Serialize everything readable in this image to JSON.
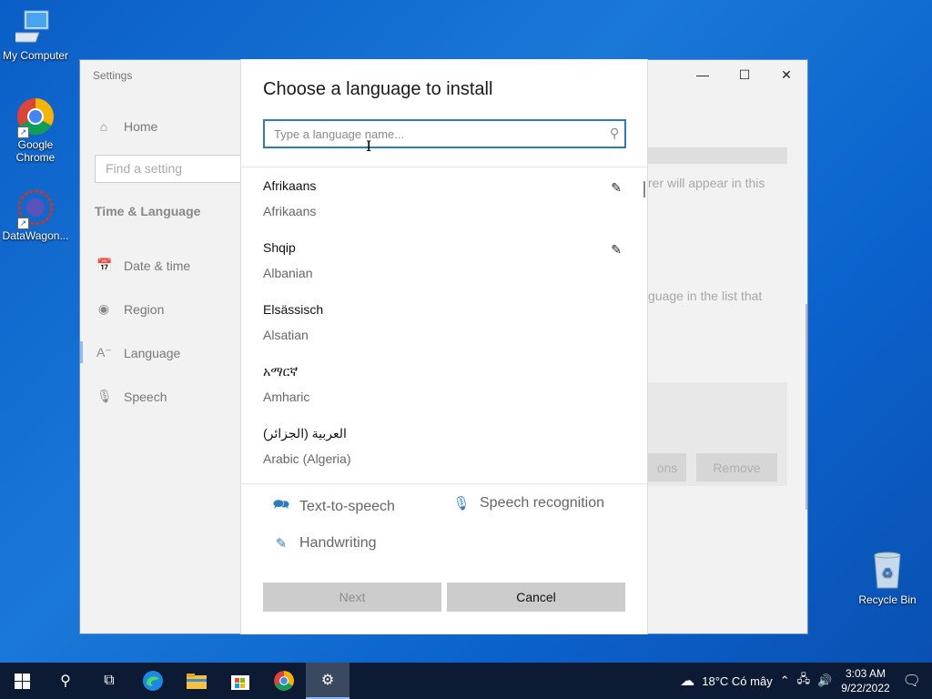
{
  "desktop": {
    "icons": [
      {
        "label": "My Computer",
        "icon": "computer-icon"
      },
      {
        "label": "Google Chrome",
        "icon": "chrome-icon"
      },
      {
        "label": "DataWagon...",
        "icon": "datawagon-icon"
      },
      {
        "label": "Recycle Bin",
        "icon": "recycle-bin-icon"
      }
    ]
  },
  "settings": {
    "title": "Settings",
    "home": "Home",
    "search_placeholder": "Find a setting",
    "section": "Time & Language",
    "nav": [
      {
        "label": "Date & time",
        "icon": "calendar-clock-icon"
      },
      {
        "label": "Region",
        "icon": "globe-icon"
      },
      {
        "label": "Language",
        "icon": "language-icon"
      },
      {
        "label": "Speech",
        "icon": "microphone-icon"
      }
    ],
    "bg_text1": "rer will appear in this",
    "bg_text2": "guage in the list that",
    "bg_btn1": "ons",
    "bg_btn2": "Remove"
  },
  "dialog": {
    "title": "Choose a language to install",
    "search_placeholder": "Type a language name...",
    "languages": [
      {
        "native": "Afrikaans",
        "english": "Afrikaans",
        "handwriting": true
      },
      {
        "native": "Shqip",
        "english": "Albanian",
        "handwriting": true
      },
      {
        "native": "Elsässisch",
        "english": "Alsatian",
        "handwriting": false
      },
      {
        "native": "አማርኛ",
        "english": "Amharic",
        "handwriting": false
      },
      {
        "native": "العربية (الجزائر)",
        "english": "Arabic (Algeria)",
        "handwriting": false
      }
    ],
    "features": {
      "tts": "Text-to-speech",
      "speech": "Speech recognition",
      "handwriting": "Handwriting"
    },
    "next": "Next",
    "cancel": "Cancel"
  },
  "taskbar": {
    "weather": "18°C  Có mây",
    "time": "3:03 AM",
    "date": "9/22/2022"
  }
}
